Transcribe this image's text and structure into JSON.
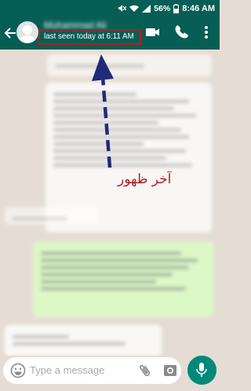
{
  "status_bar": {
    "battery": "56%",
    "time": "8:46 AM"
  },
  "header": {
    "contact_name": "Muhammad Ali",
    "last_seen": "last seen today at 6:11 AM"
  },
  "annotation": {
    "text": "آخر ظهور"
  },
  "input": {
    "placeholder": "Type a message"
  },
  "icons": {
    "back": "arrow-left-icon",
    "video": "video-call-icon",
    "call": "phone-icon",
    "menu": "more-vert-icon",
    "emoji": "emoji-icon",
    "attach": "paperclip-icon",
    "camera": "camera-icon",
    "mic": "mic-icon"
  },
  "colors": {
    "header": "#075e54",
    "chat_background": "#e5ddd5",
    "incoming_bubble": "#ffffff",
    "outgoing_bubble": "#dcf8c6",
    "annotation": "#b01f1f",
    "arrow": "#1f2a7a",
    "mic_button": "#00897b"
  }
}
